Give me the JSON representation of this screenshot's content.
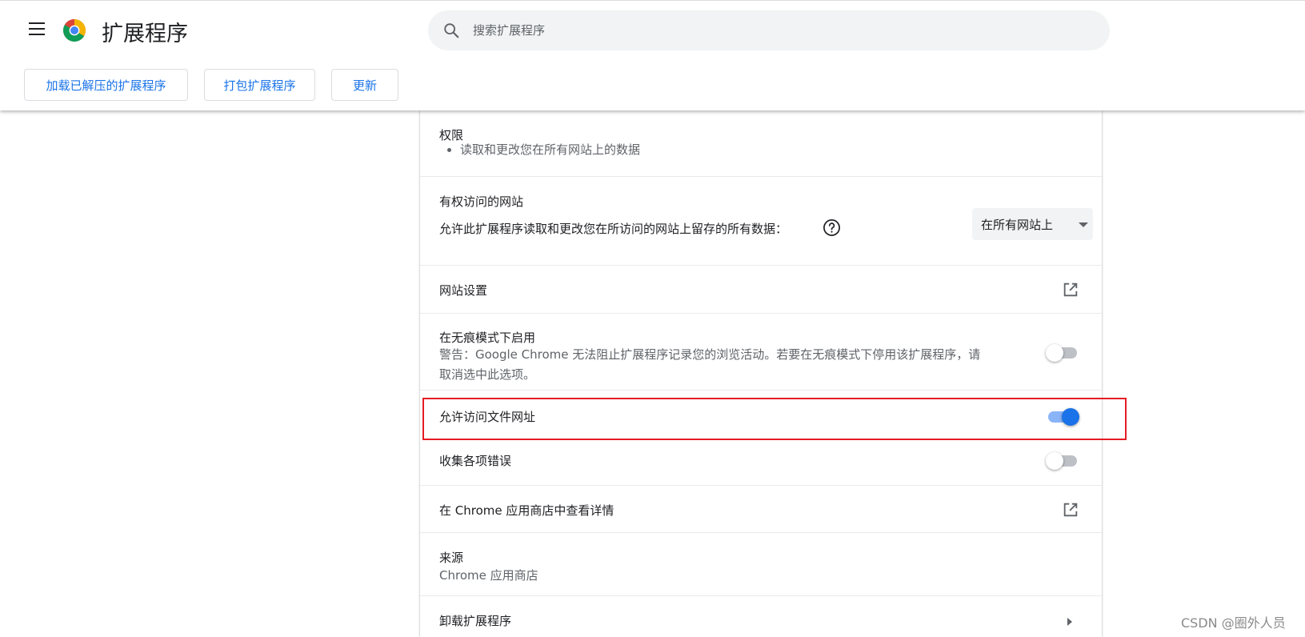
{
  "header": {
    "title": "扩展程序",
    "search_placeholder": "搜索扩展程序",
    "menu_icon": "hamburger-menu-icon",
    "logo_icon": "chrome-logo-icon"
  },
  "toolbar": {
    "load_unpacked_label": "加载已解压的扩展程序",
    "pack_label": "打包扩展程序",
    "update_label": "更新"
  },
  "details": {
    "permissions": {
      "title": "权限",
      "items": [
        "读取和更改您在所有网站上的数据"
      ]
    },
    "site_access": {
      "title": "有权访问的网站",
      "description": "允许此扩展程序读取和更改您在所访问的网站上留存的所有数据：",
      "selected_option": "在所有网站上"
    },
    "site_settings": {
      "label": "网站设置"
    },
    "incognito": {
      "label": "在无痕模式下启用",
      "warning_line1": "警告：Google Chrome 无法阻止扩展程序记录您的浏览活动。若要在无痕模式下停用该扩展程序，请",
      "warning_line2": "取消选中此选项。",
      "enabled": false
    },
    "file_urls": {
      "label": "允许访问文件网址",
      "enabled": true
    },
    "collect_errors": {
      "label": "收集各项错误",
      "enabled": false
    },
    "web_store": {
      "label": "在 Chrome 应用商店中查看详情"
    },
    "source": {
      "title": "来源",
      "value": "Chrome 应用商店"
    },
    "uninstall": {
      "label": "卸载扩展程序"
    }
  },
  "watermark": "CSDN @圈外人员",
  "colors": {
    "accent": "#1a73e8",
    "highlight": "#e51c23",
    "toggle_off": "#bdc1c6"
  }
}
